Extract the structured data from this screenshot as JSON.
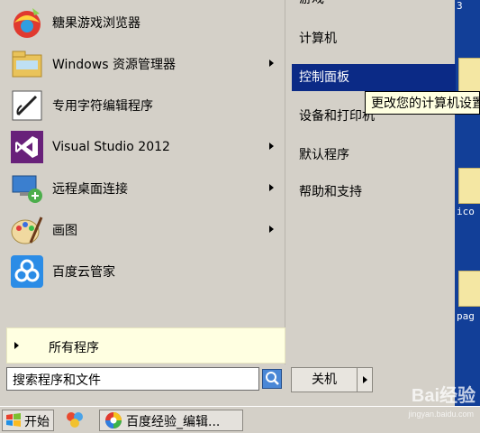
{
  "desktop": {
    "labels": [
      "3",
      "ico",
      "pag"
    ]
  },
  "start_menu": {
    "programs": [
      {
        "label": "糖果游戏浏览器",
        "icon": "candy-browser-icon",
        "has_submenu": false
      },
      {
        "label": "Windows 资源管理器",
        "icon": "explorer-folder-icon",
        "has_submenu": true
      },
      {
        "label": "专用字符编辑程序",
        "icon": "char-editor-icon",
        "has_submenu": false
      },
      {
        "label": "Visual Studio 2012",
        "icon": "visual-studio-icon",
        "has_submenu": true
      },
      {
        "label": "远程桌面连接",
        "icon": "remote-desktop-icon",
        "has_submenu": true
      },
      {
        "label": "画图",
        "icon": "paint-icon",
        "has_submenu": true
      },
      {
        "label": "百度云管家",
        "icon": "baidu-cloud-icon",
        "has_submenu": false
      }
    ],
    "all_programs_label": "所有程序",
    "search_placeholder": "搜索程序和文件",
    "shutdown_label": "关机",
    "right_items": [
      {
        "label": "游戏"
      },
      {
        "label": "计算机"
      },
      {
        "label": "控制面板",
        "selected": true
      },
      {
        "label": "设备和打印机"
      },
      {
        "label": "默认程序"
      },
      {
        "label": "帮助和支持"
      }
    ],
    "tooltip": "更改您的计算机设置"
  },
  "taskbar": {
    "start_label": "开始",
    "task_label": "百度经验_编辑..."
  },
  "watermark": {
    "main": "Bai经验",
    "sub": "jingyan.baidu.com"
  },
  "colors": {
    "menu_bg": "#d4d0c8",
    "selection": "#0b2a86",
    "tooltip_bg": "#ffffe1",
    "desktop": "#123f98"
  }
}
